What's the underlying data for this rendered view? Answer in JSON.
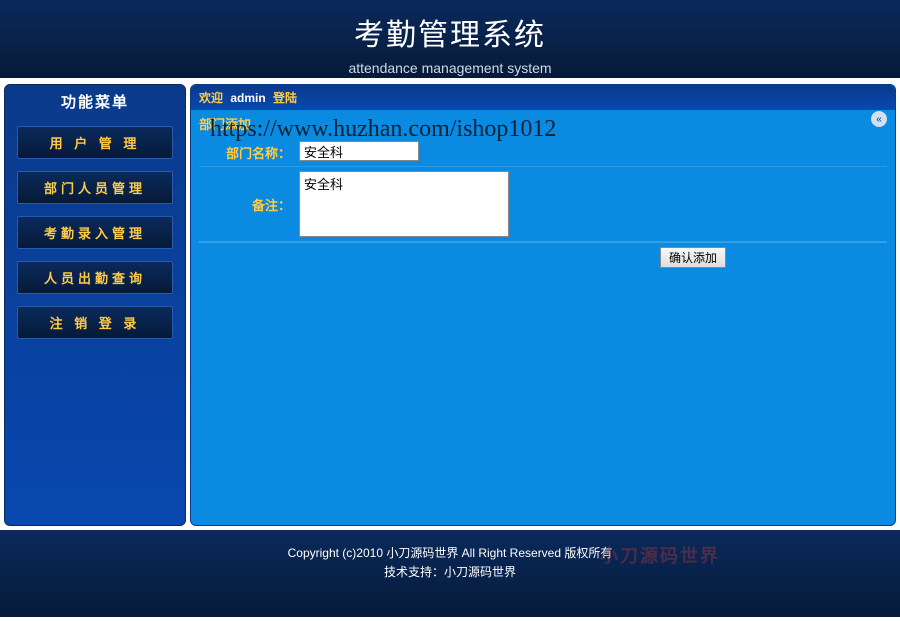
{
  "header": {
    "title": "考勤管理系统",
    "subtitle": "attendance management system"
  },
  "sidebar": {
    "title": "功能菜单",
    "items": [
      {
        "label": "用 户 管 理"
      },
      {
        "label": "部门人员管理"
      },
      {
        "label": "考勤录入管理"
      },
      {
        "label": "人员出勤查询"
      },
      {
        "label": "注 销 登 录"
      }
    ]
  },
  "main": {
    "welcome": {
      "w1": "欢迎",
      "w2": "admin",
      "w3": "登陆"
    },
    "section_title": "部门添加",
    "form": {
      "name_label": "部门名称：",
      "name_value": "安全科",
      "remark_label": "备注：",
      "remark_value": "安全科",
      "submit_label": "确认添加"
    },
    "back_icon_glyph": "«"
  },
  "footer": {
    "line1": "Copyright (c)2010   小刀源码世界   All Right Reserved   版权所有",
    "line2": "技术支持：小刀源码世界",
    "wm": "小刀源码世界"
  },
  "watermark": "https://www.huzhan.com/ishop1012"
}
